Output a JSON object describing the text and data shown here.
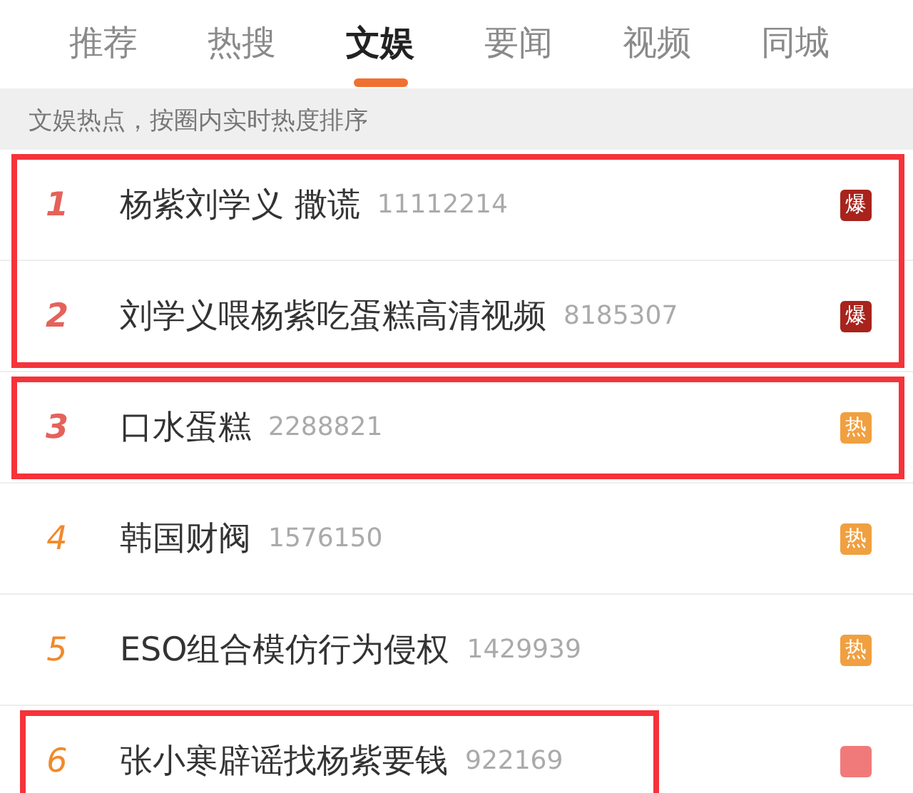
{
  "tabs": [
    {
      "label": "推荐",
      "selected": false
    },
    {
      "label": "热搜",
      "selected": false
    },
    {
      "label": "文娱",
      "selected": true
    },
    {
      "label": "要闻",
      "selected": false
    },
    {
      "label": "视频",
      "selected": false
    },
    {
      "label": "同城",
      "selected": false
    }
  ],
  "subheader": "文娱热点，按圈内实时热度排序",
  "groups": [
    {
      "kind": "wide",
      "rows": [
        {
          "rank": "1",
          "title": "杨紫刘学义 撒谎",
          "count": "11112214",
          "badge": {
            "kind": "boom",
            "label": "爆"
          }
        },
        {
          "rank": "2",
          "title": "刘学义喂杨紫吃蛋糕高清视频",
          "count": "8185307",
          "badge": {
            "kind": "boom",
            "label": "爆"
          }
        }
      ]
    },
    {
      "kind": "wide",
      "rows": [
        {
          "rank": "3",
          "title": "口水蛋糕",
          "count": "2288821",
          "badge": {
            "kind": "hot",
            "label": "热"
          }
        }
      ]
    },
    {
      "kind": "plain",
      "rows": [
        {
          "rank": "4",
          "title": "韩国财阀",
          "count": "1576150",
          "badge": {
            "kind": "hot",
            "label": "热"
          }
        },
        {
          "rank": "5",
          "title": "ESO组合模仿行为侵权",
          "count": "1429939",
          "badge": {
            "kind": "hot",
            "label": "热"
          }
        }
      ]
    },
    {
      "kind": "text",
      "rows": [
        {
          "rank": "6",
          "title": "张小寒辟谣找杨紫要钱",
          "count": "922169",
          "badge": {
            "kind": "new"
          }
        }
      ]
    }
  ]
}
